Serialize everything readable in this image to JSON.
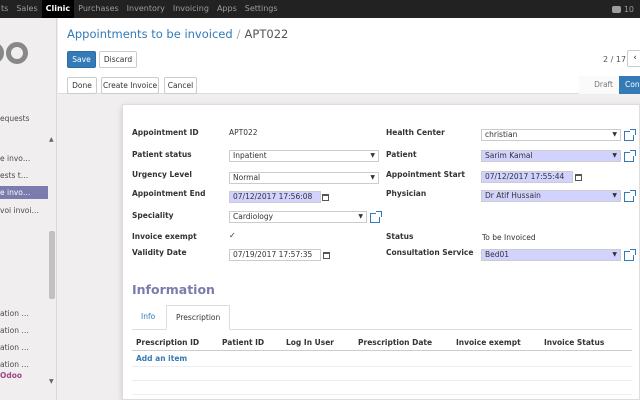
{
  "topbar": {
    "menu": [
      "ts",
      "Sales",
      "Clinic",
      "Purchases",
      "Inventory",
      "Invoicing",
      "Apps",
      "Settings"
    ],
    "active_menu": "Clinic",
    "chat_count": "10"
  },
  "sidebar": {
    "items": [
      {
        "label": "equests",
        "active": false
      },
      {
        "label": "e invo…",
        "active": false
      },
      {
        "label": "ests t…",
        "active": false
      },
      {
        "label": "e invo…",
        "active": true
      },
      {
        "label": "voi invoi…",
        "active": false
      },
      {
        "label": "ation …",
        "active": false
      },
      {
        "label": "ation …",
        "active": false
      },
      {
        "label": "ation …",
        "active": false
      },
      {
        "label": "ation …",
        "active": false
      }
    ],
    "powered_prefix": "",
    "powered_brand": "Odoo"
  },
  "breadcrumb": {
    "parent": "Appointments to be invoiced",
    "separator": "/",
    "current": "APT022"
  },
  "buttons": {
    "save": "Save",
    "discard": "Discard",
    "done": "Done",
    "create_invoice": "Create Invoice",
    "cancel": "Cancel"
  },
  "pager": {
    "text": "2 / 17",
    "prev_icon": "‹"
  },
  "status_stages": [
    "Draft",
    "Confi"
  ],
  "form": {
    "appointment_id_label": "Appointment ID",
    "appointment_id": "APT022",
    "patient_status_label": "Patient status",
    "patient_status": "Inpatient",
    "urgency_label": "Urgency Level",
    "urgency": "Normal",
    "appt_end_label": "Appointment End",
    "appt_end": "07/12/2017 17:56:08",
    "speciality_label": "Speciality",
    "speciality": "Cardiology",
    "invoice_exempt_label": "Invoice exempt",
    "validity_label": "Validity Date",
    "validity": "07/19/2017 17:57:35",
    "health_center_label": "Health Center",
    "health_center": "christian",
    "patient_label": "Patient",
    "patient": "Sarim Kamal",
    "appt_start_label": "Appointment Start",
    "appt_start": "07/12/2017 17:55:44",
    "physician_label": "Physician",
    "physician": "Dr Atif Hussain",
    "status_label": "Status",
    "status": "To be Invoiced",
    "consultation_label": "Consultation Service",
    "consultation": "Bed01"
  },
  "information": {
    "title": "Information",
    "tabs": [
      "Info",
      "Prescription"
    ],
    "active_tab": "Prescription",
    "columns": [
      "Prescription ID",
      "Patient ID",
      "Log In User",
      "Prescription Date",
      "Invoice exempt",
      "Invoice Status"
    ],
    "add_item": "Add an item"
  }
}
